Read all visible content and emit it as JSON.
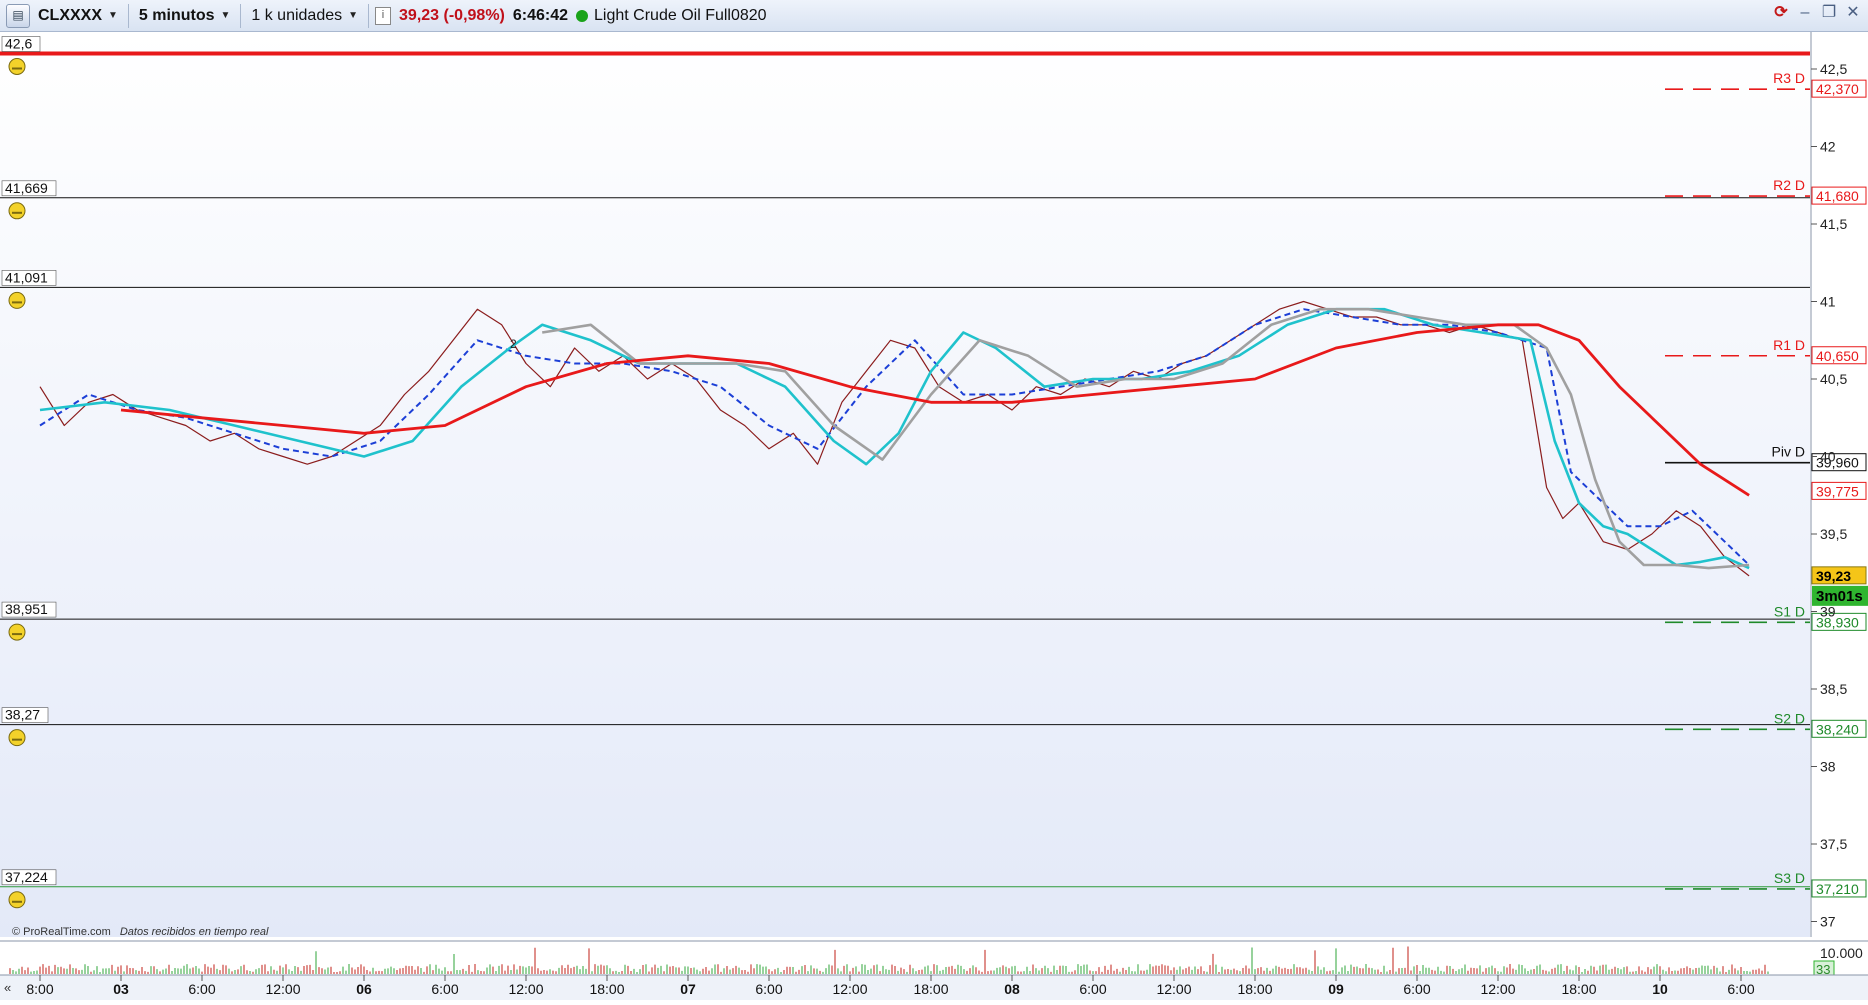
{
  "toolbar": {
    "symbol": "CLXXXX",
    "timeframe": "5 minutos",
    "units": "1 k unidades",
    "price_change": "39,23 (-0,98%)",
    "time": "6:46:42",
    "instrument": "Light Crude Oil Full0820",
    "status_color": "#1aa31a"
  },
  "footer": {
    "copyright": "© ProRealTime.com",
    "data_note": "Datos recibidos en tiempo real"
  },
  "chart_data": {
    "type": "line",
    "title": "Light Crude Oil Full0820",
    "ylim": [
      36.9,
      42.7
    ],
    "y_ticks": [
      {
        "value": 42.5,
        "label": "42,5"
      },
      {
        "value": 42.0,
        "label": "42"
      },
      {
        "value": 41.5,
        "label": "41,5"
      },
      {
        "value": 41.0,
        "label": "41"
      },
      {
        "value": 40.5,
        "label": "40,5"
      },
      {
        "value": 40.0,
        "label": "40"
      },
      {
        "value": 39.5,
        "label": "39,5"
      },
      {
        "value": 39.0,
        "label": "39"
      },
      {
        "value": 38.5,
        "label": "38,5"
      },
      {
        "value": 38.0,
        "label": "38"
      },
      {
        "value": 37.5,
        "label": "37,5"
      },
      {
        "value": 37.0,
        "label": "37"
      }
    ],
    "x_ticks": [
      {
        "t": 0,
        "label": "8:00",
        "bold": false
      },
      {
        "t": 1,
        "label": "03",
        "bold": true
      },
      {
        "t": 2,
        "label": "6:00",
        "bold": false
      },
      {
        "t": 3,
        "label": "12:00",
        "bold": false
      },
      {
        "t": 4,
        "label": "06",
        "bold": true
      },
      {
        "t": 5,
        "label": "6:00",
        "bold": false
      },
      {
        "t": 6,
        "label": "12:00",
        "bold": false
      },
      {
        "t": 7,
        "label": "18:00",
        "bold": false
      },
      {
        "t": 8,
        "label": "07",
        "bold": true
      },
      {
        "t": 9,
        "label": "6:00",
        "bold": false
      },
      {
        "t": 10,
        "label": "12:00",
        "bold": false
      },
      {
        "t": 11,
        "label": "18:00",
        "bold": false
      },
      {
        "t": 12,
        "label": "08",
        "bold": true
      },
      {
        "t": 13,
        "label": "6:00",
        "bold": false
      },
      {
        "t": 14,
        "label": "12:00",
        "bold": false
      },
      {
        "t": 15,
        "label": "18:00",
        "bold": false
      },
      {
        "t": 16,
        "label": "09",
        "bold": true
      },
      {
        "t": 17,
        "label": "6:00",
        "bold": false
      },
      {
        "t": 18,
        "label": "12:00",
        "bold": false
      },
      {
        "t": 19,
        "label": "18:00",
        "bold": false
      },
      {
        "t": 20,
        "label": "10",
        "bold": true
      },
      {
        "t": 21,
        "label": "6:00",
        "bold": false
      }
    ],
    "alert_lines": [
      {
        "value": 42.6,
        "label": "42,6",
        "color": "#e8191a",
        "thick": true
      },
      {
        "value": 41.669,
        "label": "41,669",
        "color": "#111111",
        "thick": false
      },
      {
        "value": 41.091,
        "label": "41,091",
        "color": "#111111",
        "thick": false
      },
      {
        "value": 38.951,
        "label": "38,951",
        "color": "#111111",
        "thick": false
      },
      {
        "value": 38.27,
        "label": "38,27",
        "color": "#111111",
        "thick": false
      },
      {
        "value": 37.224,
        "label": "37,224",
        "color": "#2e9a3a",
        "thick": false
      }
    ],
    "pivot_levels": [
      {
        "name": "R3 D",
        "value": 42.37,
        "label": "42,370",
        "color": "#e8191a"
      },
      {
        "name": "R2 D",
        "value": 41.68,
        "label": "41,680",
        "color": "#e8191a"
      },
      {
        "name": "R1 D",
        "value": 40.65,
        "label": "40,650",
        "color": "#e8191a"
      },
      {
        "name": "Piv D",
        "value": 39.96,
        "label": "39,960",
        "color": "#111111"
      },
      {
        "name": "S1 D",
        "value": 38.93,
        "label": "38,930",
        "color": "#1f8a2a"
      },
      {
        "name": "S2 D",
        "value": 38.24,
        "label": "38,240",
        "color": "#1f8a2a"
      },
      {
        "name": "S3 D",
        "value": 37.21,
        "label": "37,210",
        "color": "#1f8a2a"
      }
    ],
    "right_badges": [
      {
        "value": 39.775,
        "label": "39,775",
        "color": "#e8191a"
      },
      {
        "value": 39.23,
        "label": "39,23",
        "color": "#000000"
      }
    ],
    "countdown": "3m01s",
    "volume_label": "10.000",
    "volume_current": "33",
    "marker_text": "2",
    "series": [
      {
        "role": "price",
        "color": "#8b1d1d",
        "x": [
          0,
          0.3,
          0.6,
          0.9,
          1.2,
          1.5,
          1.8,
          2.1,
          2.4,
          2.7,
          3.0,
          3.3,
          3.6,
          3.9,
          4.2,
          4.5,
          4.8,
          5.1,
          5.4,
          5.7,
          6.0,
          6.3,
          6.6,
          6.9,
          7.2,
          7.5,
          7.8,
          8.1,
          8.4,
          8.7,
          9.0,
          9.3,
          9.6,
          9.9,
          10.2,
          10.5,
          10.8,
          11.1,
          11.4,
          11.7,
          12.0,
          12.3,
          12.6,
          12.9,
          13.2,
          13.5,
          13.8,
          14.1,
          14.4,
          14.7,
          15.0,
          15.3,
          15.6,
          15.9,
          16.2,
          16.5,
          16.8,
          17.1,
          17.4,
          17.7,
          18.0,
          18.3,
          18.6,
          18.8,
          19.0,
          19.3,
          19.6,
          19.9,
          20.2,
          20.5,
          20.8,
          21.1
        ],
        "y": [
          40.45,
          40.2,
          40.35,
          40.4,
          40.3,
          40.25,
          40.2,
          40.1,
          40.15,
          40.05,
          40.0,
          39.95,
          40.0,
          40.1,
          40.2,
          40.4,
          40.55,
          40.75,
          40.95,
          40.85,
          40.6,
          40.45,
          40.7,
          40.55,
          40.65,
          40.5,
          40.6,
          40.5,
          40.3,
          40.2,
          40.05,
          40.15,
          39.95,
          40.35,
          40.55,
          40.75,
          40.7,
          40.45,
          40.35,
          40.4,
          40.3,
          40.45,
          40.4,
          40.5,
          40.45,
          40.55,
          40.5,
          40.6,
          40.65,
          40.75,
          40.85,
          40.95,
          41.0,
          40.95,
          40.9,
          40.9,
          40.85,
          40.85,
          40.8,
          40.85,
          40.8,
          40.75,
          39.8,
          39.6,
          39.7,
          39.45,
          39.4,
          39.5,
          39.65,
          39.55,
          39.35,
          39.23
        ]
      },
      {
        "role": "ma-dashed",
        "color": "#1c3fd6",
        "x": [
          0,
          0.6,
          1.2,
          1.8,
          2.4,
          3.0,
          3.6,
          4.2,
          4.8,
          5.4,
          6.0,
          6.6,
          7.2,
          7.8,
          8.4,
          9.0,
          9.6,
          10.2,
          10.8,
          11.4,
          12.0,
          12.6,
          13.2,
          13.8,
          14.4,
          15.0,
          15.6,
          16.2,
          16.8,
          17.4,
          18.0,
          18.6,
          18.9,
          19.2,
          19.6,
          20.0,
          20.4,
          20.8,
          21.1
        ],
        "y": [
          40.2,
          40.4,
          40.3,
          40.25,
          40.15,
          40.05,
          40.0,
          40.1,
          40.4,
          40.75,
          40.65,
          40.6,
          40.6,
          40.55,
          40.45,
          40.2,
          40.05,
          40.45,
          40.75,
          40.4,
          40.4,
          40.45,
          40.5,
          40.55,
          40.65,
          40.85,
          40.95,
          40.9,
          40.85,
          40.85,
          40.8,
          40.7,
          39.9,
          39.75,
          39.55,
          39.55,
          39.65,
          39.45,
          39.3
        ]
      },
      {
        "role": "ma-cyan",
        "color": "#1fc2cc",
        "x": [
          0,
          0.8,
          1.6,
          2.4,
          3.2,
          4.0,
          4.6,
          5.2,
          5.8,
          6.2,
          6.8,
          7.4,
          8.0,
          8.6,
          9.2,
          9.8,
          10.2,
          10.6,
          11.0,
          11.4,
          11.8,
          12.4,
          13.0,
          13.6,
          14.2,
          14.8,
          15.4,
          16.0,
          16.6,
          17.2,
          17.8,
          18.4,
          18.7,
          19.0,
          19.3,
          19.6,
          19.9,
          20.2,
          20.5,
          20.8,
          21.1
        ],
        "y": [
          40.3,
          40.35,
          40.3,
          40.2,
          40.1,
          40.0,
          40.1,
          40.45,
          40.7,
          40.85,
          40.75,
          40.6,
          40.6,
          40.6,
          40.45,
          40.1,
          39.95,
          40.15,
          40.55,
          40.8,
          40.7,
          40.45,
          40.5,
          40.5,
          40.55,
          40.65,
          40.85,
          40.95,
          40.95,
          40.85,
          40.8,
          40.75,
          40.1,
          39.7,
          39.55,
          39.5,
          39.4,
          39.3,
          39.32,
          39.35,
          39.28
        ]
      },
      {
        "role": "ma-grey",
        "color": "#a0a0a0",
        "x": [
          6.2,
          6.8,
          7.4,
          8.0,
          8.6,
          9.2,
          9.8,
          10.4,
          11.0,
          11.6,
          12.2,
          12.8,
          13.4,
          14.0,
          14.6,
          15.2,
          15.8,
          16.4,
          17.0,
          17.6,
          18.2,
          18.6,
          18.9,
          19.2,
          19.5,
          19.8,
          20.2,
          20.6,
          21.1
        ],
        "y": [
          40.8,
          40.85,
          40.6,
          40.6,
          40.6,
          40.55,
          40.2,
          39.98,
          40.4,
          40.75,
          40.65,
          40.45,
          40.5,
          40.5,
          40.6,
          40.85,
          40.95,
          40.95,
          40.9,
          40.85,
          40.85,
          40.7,
          40.4,
          39.85,
          39.45,
          39.3,
          39.3,
          39.28,
          39.3
        ]
      },
      {
        "role": "ma-red",
        "color": "#e8191a",
        "x": [
          1.0,
          2.0,
          3.0,
          4.0,
          5.0,
          6.0,
          7.0,
          8.0,
          9.0,
          10.0,
          11.0,
          12.0,
          13.0,
          14.0,
          15.0,
          16.0,
          17.0,
          18.0,
          18.5,
          19.0,
          19.5,
          20.0,
          20.5,
          21.1
        ],
        "y": [
          40.3,
          40.25,
          40.2,
          40.15,
          40.2,
          40.45,
          40.6,
          40.65,
          40.6,
          40.45,
          40.35,
          40.35,
          40.4,
          40.45,
          40.5,
          40.7,
          40.8,
          40.85,
          40.85,
          40.75,
          40.45,
          40.2,
          39.95,
          39.75
        ]
      }
    ]
  }
}
